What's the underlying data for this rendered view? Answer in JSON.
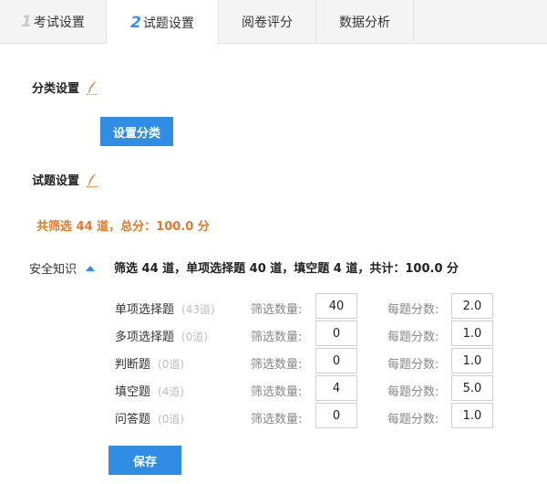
{
  "tabs": [
    {
      "num": "1",
      "label": "考试设置",
      "active": false
    },
    {
      "num": "2",
      "label": "试题设置",
      "active": true
    },
    {
      "num": "",
      "label": "阅卷评分",
      "active": false
    },
    {
      "num": "",
      "label": "数据分析",
      "active": false
    }
  ],
  "category": {
    "title": "分类设置",
    "button": "设置分类"
  },
  "questions": {
    "title": "试题设置",
    "summary": "共筛选 44 道，总分：100.0 分"
  },
  "group": {
    "name": "安全知识",
    "summary": "筛选 44 道，单项选择题 40 道，填空题 4 道，共计：100.0 分",
    "qty_label": "筛选数量:",
    "score_label": "每题分数:",
    "rows": [
      {
        "type": "单项选择题",
        "count": "(43道)",
        "qty": "40",
        "score": "2.0"
      },
      {
        "type": "多项选择题",
        "count": "(0道)",
        "qty": "0",
        "score": "1.0"
      },
      {
        "type": "判断题",
        "count": "(0道)",
        "qty": "0",
        "score": "1.0"
      },
      {
        "type": "填空题",
        "count": "(4道)",
        "qty": "4",
        "score": "5.0"
      },
      {
        "type": "问答题",
        "count": "(0道)",
        "qty": "0",
        "score": "1.0"
      }
    ]
  },
  "save_button": "保存",
  "colors": {
    "accent": "#2f8de4",
    "highlight": "#e07a2c"
  }
}
